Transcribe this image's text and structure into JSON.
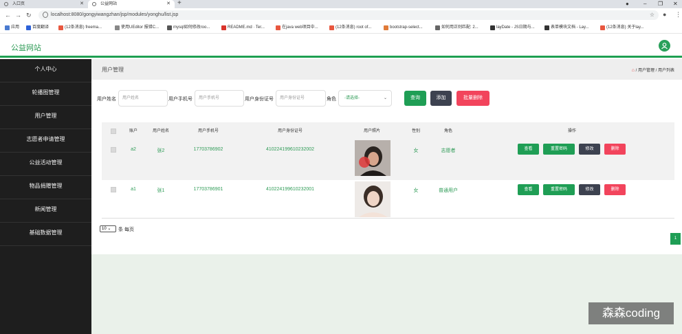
{
  "browser": {
    "tabs": [
      {
        "label": "入口页"
      },
      {
        "label": "公益网站"
      }
    ],
    "url": "localhost:8080/gongyiwangzhan/jsp/modules/yonghu/list.jsp",
    "bookmarks": [
      {
        "label": "应用",
        "color": "#4a7bd0"
      },
      {
        "label": "百度翻译",
        "color": "#2d62d8"
      },
      {
        "label": "(12条消息) freema...",
        "color": "#e8573f"
      },
      {
        "label": "使用UEditor 报错C...",
        "color": "#888888"
      },
      {
        "label": "mysql如何修改roo...",
        "color": "#555555"
      },
      {
        "label": "README.md · Ter...",
        "color": "#d9342b"
      },
      {
        "label": "在java web项目中...",
        "color": "#e8573f"
      },
      {
        "label": "(12条消息) root of...",
        "color": "#e8573f"
      },
      {
        "label": "bootstrap-select...",
        "color": "#e07b39"
      },
      {
        "label": "如何用正则匹配: 2...",
        "color": "#666666"
      },
      {
        "label": "layDate - JS日期与...",
        "color": "#333333"
      },
      {
        "label": "表单模块文档 - Lay...",
        "color": "#333333"
      },
      {
        "label": "(12条消息) 关于lay...",
        "color": "#e8573f"
      }
    ]
  },
  "header": {
    "site_title": "公益网站"
  },
  "sidebar": {
    "items": [
      {
        "label": "个人中心"
      },
      {
        "label": "轮播图管理"
      },
      {
        "label": "用户管理"
      },
      {
        "label": "志愿者申请管理"
      },
      {
        "label": "公益活动管理"
      },
      {
        "label": "物品捐赠管理"
      },
      {
        "label": "新闻管理"
      },
      {
        "label": "基础数据管理"
      }
    ]
  },
  "page": {
    "title": "用户管理",
    "breadcrumb": [
      "用户管理",
      "用户列表"
    ]
  },
  "search": {
    "name_label": "用户姓名",
    "name_placeholder": "用户姓名",
    "phone_label": "用户手机号",
    "phone_placeholder": "用户手机号",
    "id_label": "用户身份证号",
    "id_placeholder": "用户身份证号",
    "role_label": "角色",
    "role_selected": "-请选择-",
    "search_button": "查询",
    "add_button": "添加",
    "batch_delete_button": "批量删除"
  },
  "table": {
    "headers": [
      "账户",
      "用户姓名",
      "用户手机号",
      "用户身份证号",
      "用户照片",
      "性别",
      "角色",
      "操作"
    ],
    "rows": [
      {
        "account": "a2",
        "name": "张2",
        "phone": "17703786902",
        "id_number": "410224199610232002",
        "gender": "女",
        "role": "志愿者"
      },
      {
        "account": "a1",
        "name": "张1",
        "phone": "17703786901",
        "id_number": "410224199610232001",
        "gender": "女",
        "role": "普通用户"
      }
    ],
    "actions": {
      "view": "查看",
      "reset_password": "重置密码",
      "edit": "修改",
      "delete": "删除"
    }
  },
  "pagination": {
    "page_size": "10",
    "page_size_suffix": "条 每页",
    "current_page": "1"
  },
  "watermark": "森森coding",
  "colors": {
    "brand_green": "#1f9e55",
    "danger": "#f2445c",
    "dark": "#3d4250",
    "sidebar_bg": "#1e1e1e"
  }
}
